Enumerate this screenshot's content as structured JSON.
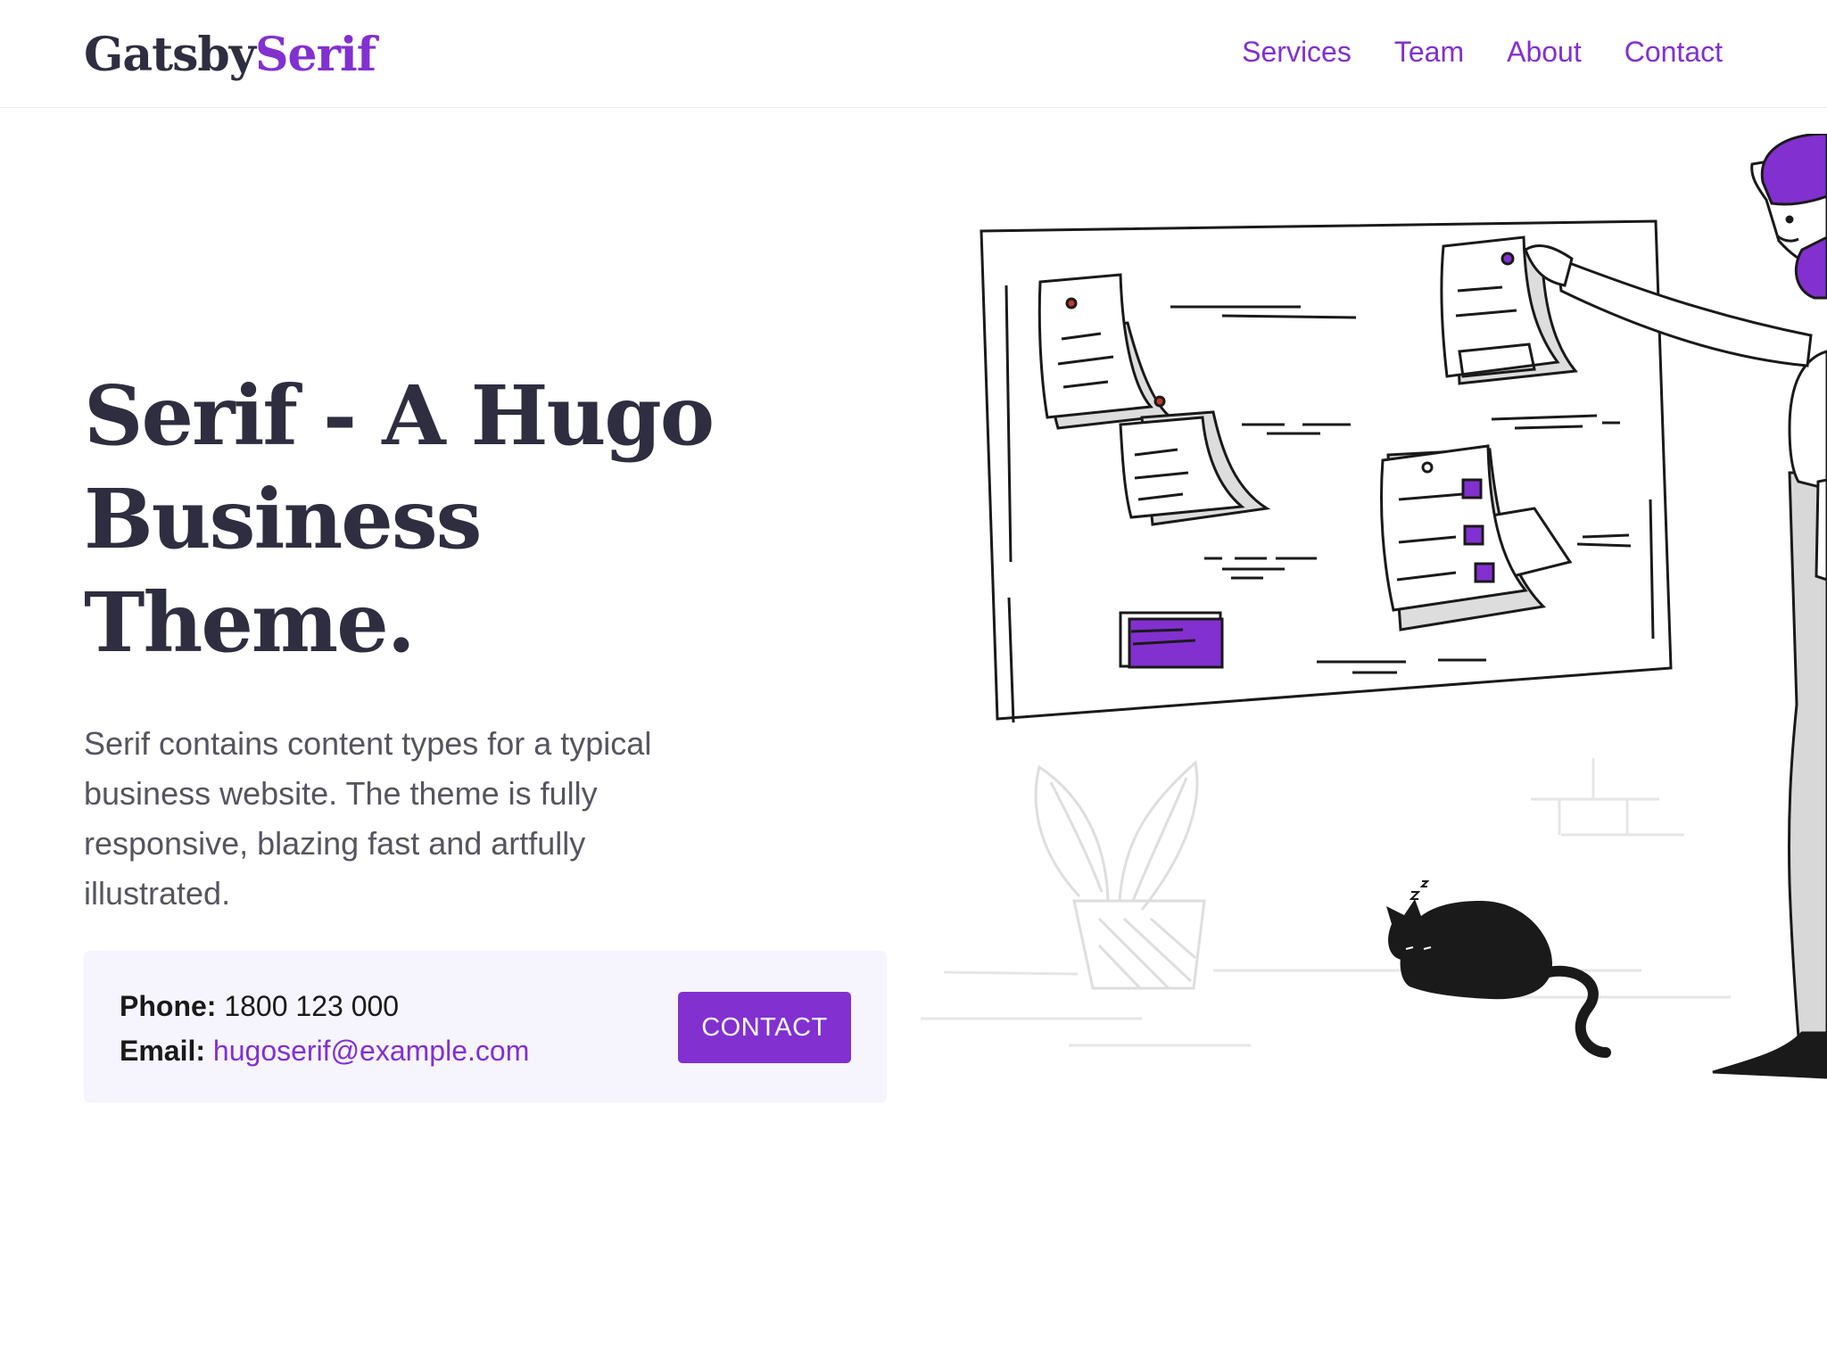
{
  "header": {
    "logo_part1": "Gatsby",
    "logo_part2": "Serif",
    "nav": [
      {
        "label": "Services"
      },
      {
        "label": "Team"
      },
      {
        "label": "About"
      },
      {
        "label": "Contact"
      }
    ]
  },
  "hero": {
    "title": "Serif - A Hugo Business Theme.",
    "description": "Serif contains content types for a typical business website. The theme is fully responsive, blazing fast and artfully illustrated."
  },
  "call": {
    "phone_label": "Phone:",
    "phone_value": "1800 123 000",
    "email_label": "Email:",
    "email_value": "hugoserif@example.com",
    "button_label": "CONTACT"
  },
  "colors": {
    "brand": "#8230d0",
    "heading": "#2e2e40",
    "body_text": "#55555f",
    "call_box_bg": "#f6f5fd"
  }
}
